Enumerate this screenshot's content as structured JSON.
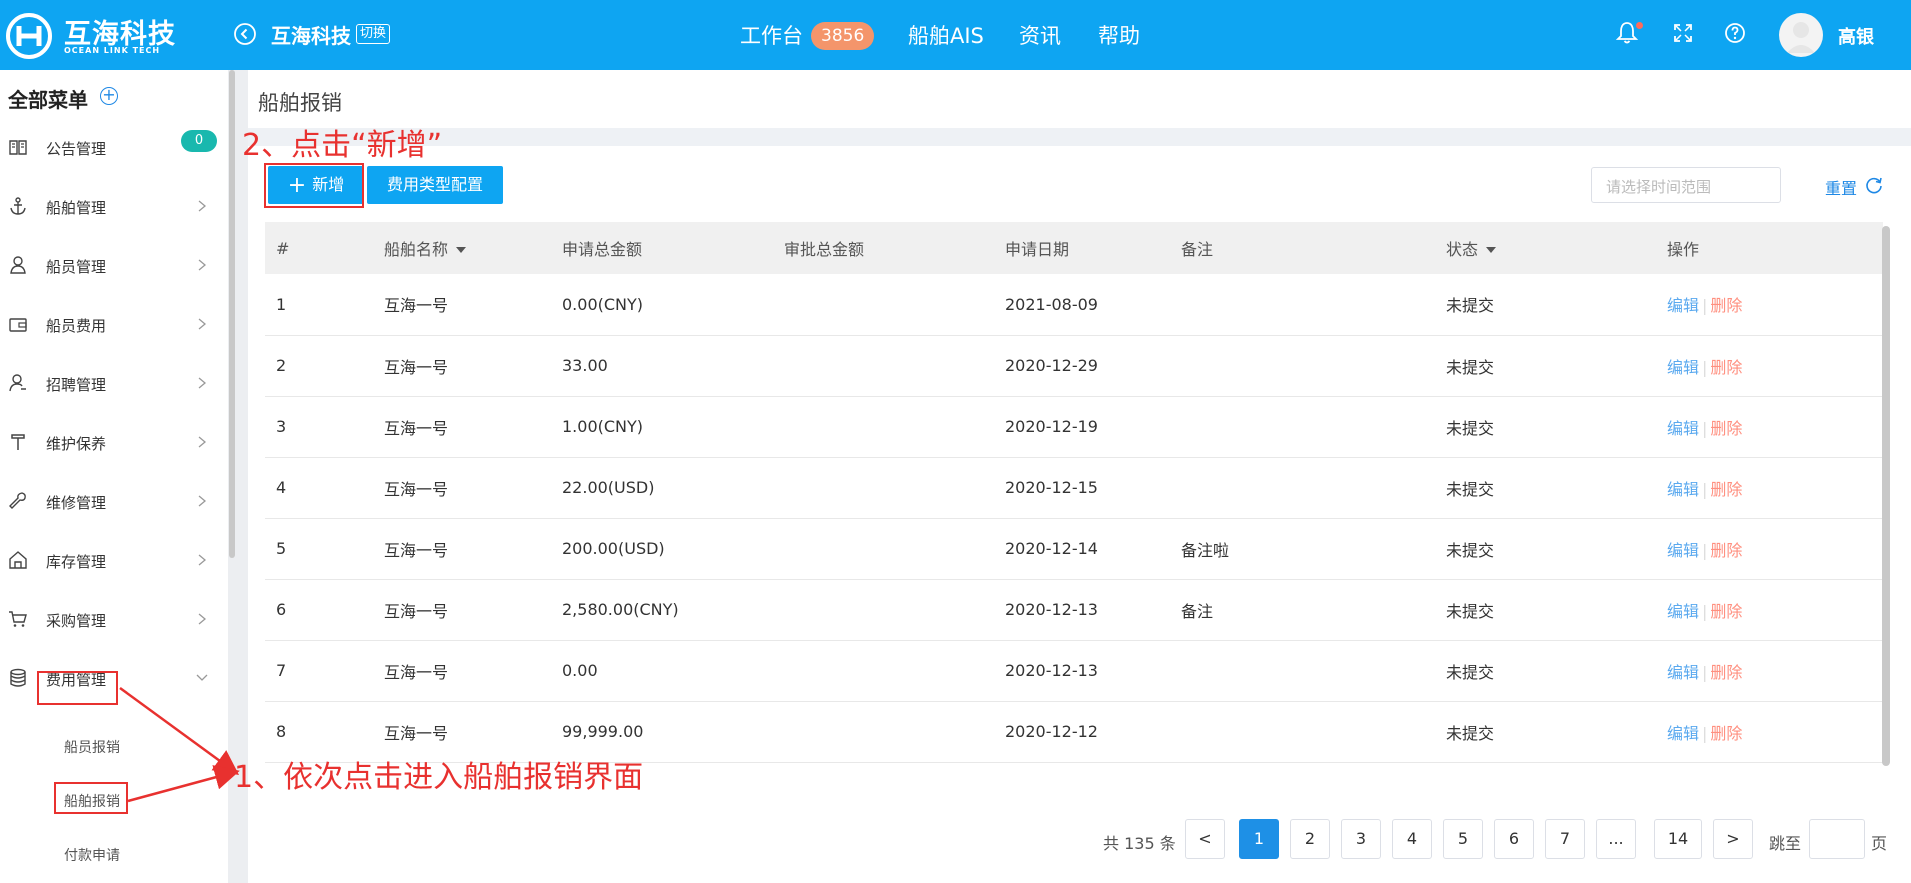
{
  "header": {
    "brand_cn": "互海科技",
    "brand_en": "OCEAN LINK TECH",
    "company": "互海科技",
    "switch_label": "切换",
    "nav": {
      "workbench": "工作台",
      "workbench_count": "3856",
      "ais": "船舶AIS",
      "news": "资讯",
      "help": "帮助"
    },
    "username": "高银",
    "icons": [
      "back-arrow-icon",
      "bell-icon",
      "fullscreen-icon",
      "help-icon"
    ]
  },
  "sidebar": {
    "title": "全部菜单",
    "items": [
      {
        "label": "公告管理",
        "icon": "book-icon",
        "badge": "0"
      },
      {
        "label": "船舶管理",
        "icon": "anchor-icon"
      },
      {
        "label": "船员管理",
        "icon": "person-icon"
      },
      {
        "label": "船员费用",
        "icon": "wallet-icon"
      },
      {
        "label": "招聘管理",
        "icon": "recruit-icon"
      },
      {
        "label": "维护保养",
        "icon": "hammer-icon"
      },
      {
        "label": "维修管理",
        "icon": "wrench-icon"
      },
      {
        "label": "库存管理",
        "icon": "warehouse-icon"
      },
      {
        "label": "采购管理",
        "icon": "cart-icon"
      },
      {
        "label": "费用管理",
        "icon": "database-icon",
        "expanded": true
      }
    ],
    "sub_items": [
      "船员报销",
      "船舶报销",
      "付款申请"
    ]
  },
  "main": {
    "title": "船舶报销",
    "add_button": "新增",
    "config_button": "费用类型配置",
    "date_placeholder": "请选择时间范围",
    "reset_label": "重置",
    "columns": [
      "#",
      "船舶名称",
      "申请总金额",
      "审批总金额",
      "申请日期",
      "备注",
      "状态",
      "操作"
    ],
    "rows": [
      {
        "no": "1",
        "ship": "互海一号",
        "apply": "0.00(CNY)",
        "approve": "",
        "date": "2021-08-09",
        "note": "",
        "status": "未提交"
      },
      {
        "no": "2",
        "ship": "互海一号",
        "apply": "33.00",
        "approve": "",
        "date": "2020-12-29",
        "note": "",
        "status": "未提交"
      },
      {
        "no": "3",
        "ship": "互海一号",
        "apply": "1.00(CNY)",
        "approve": "",
        "date": "2020-12-19",
        "note": "",
        "status": "未提交"
      },
      {
        "no": "4",
        "ship": "互海一号",
        "apply": "22.00(USD)",
        "approve": "",
        "date": "2020-12-15",
        "note": "",
        "status": "未提交"
      },
      {
        "no": "5",
        "ship": "互海一号",
        "apply": "200.00(USD)",
        "approve": "",
        "date": "2020-12-14",
        "note": "备注啦",
        "status": "未提交"
      },
      {
        "no": "6",
        "ship": "互海一号",
        "apply": "2,580.00(CNY)",
        "approve": "",
        "date": "2020-12-13",
        "note": "备注",
        "status": "未提交"
      },
      {
        "no": "7",
        "ship": "互海一号",
        "apply": "0.00",
        "approve": "",
        "date": "2020-12-13",
        "note": "",
        "status": "未提交"
      },
      {
        "no": "8",
        "ship": "互海一号",
        "apply": "99,999.00",
        "approve": "",
        "date": "2020-12-12",
        "note": "",
        "status": "未提交"
      }
    ],
    "row_actions": {
      "edit": "编辑",
      "sep": "|",
      "delete": "删除"
    }
  },
  "pagination": {
    "total": "共 135 条",
    "prev": "<",
    "next": ">",
    "pages": [
      "1",
      "2",
      "3",
      "4",
      "5",
      "6",
      "7",
      "...",
      "14"
    ],
    "current": "1",
    "jump_label": "跳至",
    "page_unit": "页"
  },
  "annotations": {
    "step1": "1、依次点击进入船舶报销界面",
    "step2": "2、点击“新增”"
  },
  "colors": {
    "header_bg": "#0ea5f2",
    "primary": "#0ea5f2",
    "badge": "#f4956b",
    "teal_badge": "#19b8ae",
    "delete": "#ff8f7f",
    "annotation": "#e8312f"
  }
}
